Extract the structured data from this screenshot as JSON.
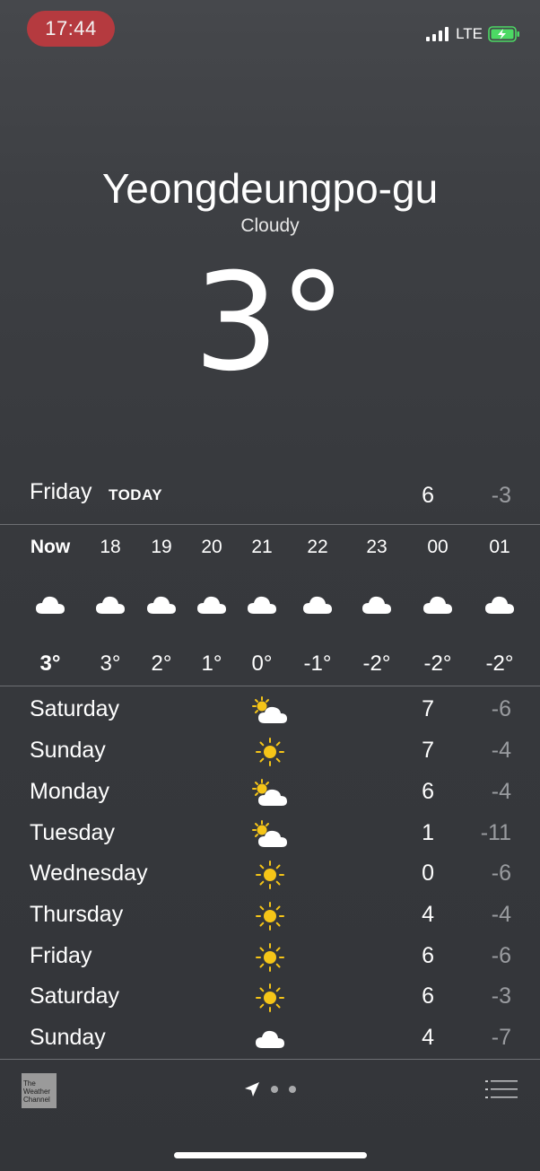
{
  "status_bar": {
    "time": "17:44",
    "network": "LTE",
    "icons": [
      "signal-icon",
      "battery-charging-icon"
    ]
  },
  "location": {
    "city": "Yeongdeungpo-gu",
    "condition": "Cloudy",
    "temperature": "3°"
  },
  "today": {
    "day": "Friday",
    "tag": "TODAY",
    "high": "6",
    "low": "-3"
  },
  "hourly": [
    {
      "time": "Now",
      "icon": "cloud-icon",
      "temp": "3°"
    },
    {
      "time": "18",
      "icon": "cloud-icon",
      "temp": "3°"
    },
    {
      "time": "19",
      "icon": "cloud-icon",
      "temp": "2°"
    },
    {
      "time": "20",
      "icon": "cloud-icon",
      "temp": "1°"
    },
    {
      "time": "21",
      "icon": "cloud-icon",
      "temp": "0°"
    },
    {
      "time": "22",
      "icon": "cloud-icon",
      "temp": "-1°"
    },
    {
      "time": "23",
      "icon": "cloud-icon",
      "temp": "-2°"
    },
    {
      "time": "00",
      "icon": "cloud-icon",
      "temp": "-2°"
    },
    {
      "time": "01",
      "icon": "cloud-icon",
      "temp": "-2°"
    }
  ],
  "daily": [
    {
      "day": "Saturday",
      "icon": "partly-sunny-icon",
      "high": "7",
      "low": "-6"
    },
    {
      "day": "Sunday",
      "icon": "sun-icon",
      "high": "7",
      "low": "-4"
    },
    {
      "day": "Monday",
      "icon": "partly-sunny-icon",
      "high": "6",
      "low": "-4"
    },
    {
      "day": "Tuesday",
      "icon": "partly-sunny-icon",
      "high": "1",
      "low": "-11"
    },
    {
      "day": "Wednesday",
      "icon": "sun-icon",
      "high": "0",
      "low": "-6"
    },
    {
      "day": "Thursday",
      "icon": "sun-icon",
      "high": "4",
      "low": "-4"
    },
    {
      "day": "Friday",
      "icon": "sun-icon",
      "high": "6",
      "low": "-6"
    },
    {
      "day": "Saturday",
      "icon": "sun-icon",
      "high": "6",
      "low": "-3"
    },
    {
      "day": "Sunday",
      "icon": "cloud-icon",
      "high": "4",
      "low": "-7"
    }
  ],
  "footer": {
    "logo_text": "The Weather Channel",
    "icons": [
      "location-arrow-icon",
      "page-dot-icon",
      "page-dot-icon",
      "list-icon"
    ]
  },
  "colors": {
    "sun": "#f5c518",
    "low_temp": "#9a9ca0",
    "time_pill": "#b53a3f",
    "battery": "#4cd964"
  }
}
